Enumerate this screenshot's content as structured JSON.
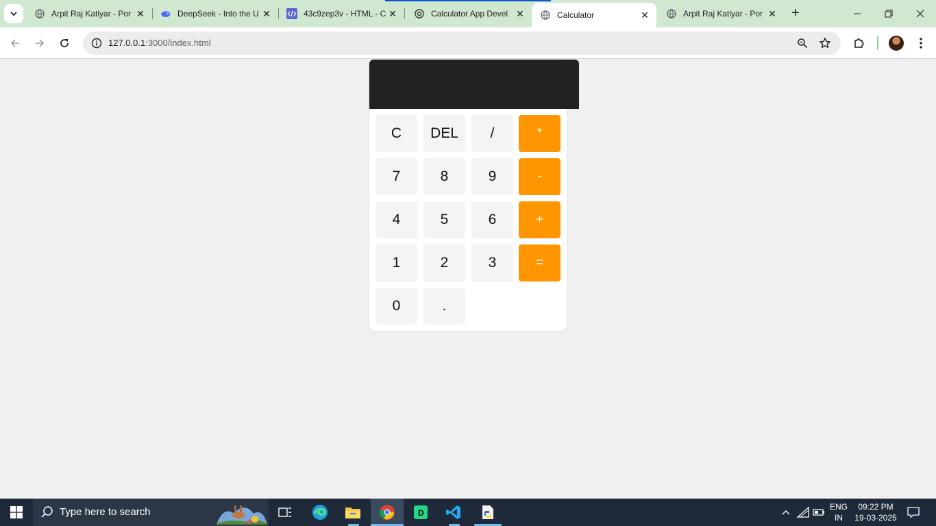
{
  "browser": {
    "tabs": [
      {
        "title": "Arpit Raj Katiyar - Por",
        "active": false,
        "favicon": "globe-icon"
      },
      {
        "title": "DeepSeek - Into the U",
        "active": false,
        "favicon": "deepseek-whale-icon"
      },
      {
        "title": "43c9zep3v - HTML - C",
        "active": false,
        "favicon": "code-brackets-icon"
      },
      {
        "title": "Calculator App Devel",
        "active": false,
        "favicon": "openai-icon"
      },
      {
        "title": "Calculator",
        "active": true,
        "favicon": "globe-icon"
      },
      {
        "title": "Arpit Raj Katiyar - Por",
        "active": false,
        "favicon": "globe-icon"
      }
    ],
    "url_host": "127.0.0.1",
    "url_rest": ":3000/index.html"
  },
  "calculator": {
    "display_value": "",
    "keys": [
      {
        "label": "C",
        "type": "func"
      },
      {
        "label": "DEL",
        "type": "func"
      },
      {
        "label": "/",
        "type": "func"
      },
      {
        "label": "*",
        "type": "op"
      },
      {
        "label": "7",
        "type": "num"
      },
      {
        "label": "8",
        "type": "num"
      },
      {
        "label": "9",
        "type": "num"
      },
      {
        "label": "-",
        "type": "op"
      },
      {
        "label": "4",
        "type": "num"
      },
      {
        "label": "5",
        "type": "num"
      },
      {
        "label": "6",
        "type": "num"
      },
      {
        "label": "+",
        "type": "op"
      },
      {
        "label": "1",
        "type": "num"
      },
      {
        "label": "2",
        "type": "num"
      },
      {
        "label": "3",
        "type": "num"
      },
      {
        "label": "=",
        "type": "op"
      },
      {
        "label": "0",
        "type": "num"
      },
      {
        "label": ".",
        "type": "num"
      }
    ],
    "colors": {
      "display_bg": "#222222",
      "operator_bg": "#ff9500",
      "key_bg": "#f4f4f4"
    }
  },
  "taskbar": {
    "search_placeholder": "Type here to search",
    "lang_line1": "ENG",
    "lang_line2": "IN",
    "time": "09:22 PM",
    "date": "19-03-2025"
  }
}
